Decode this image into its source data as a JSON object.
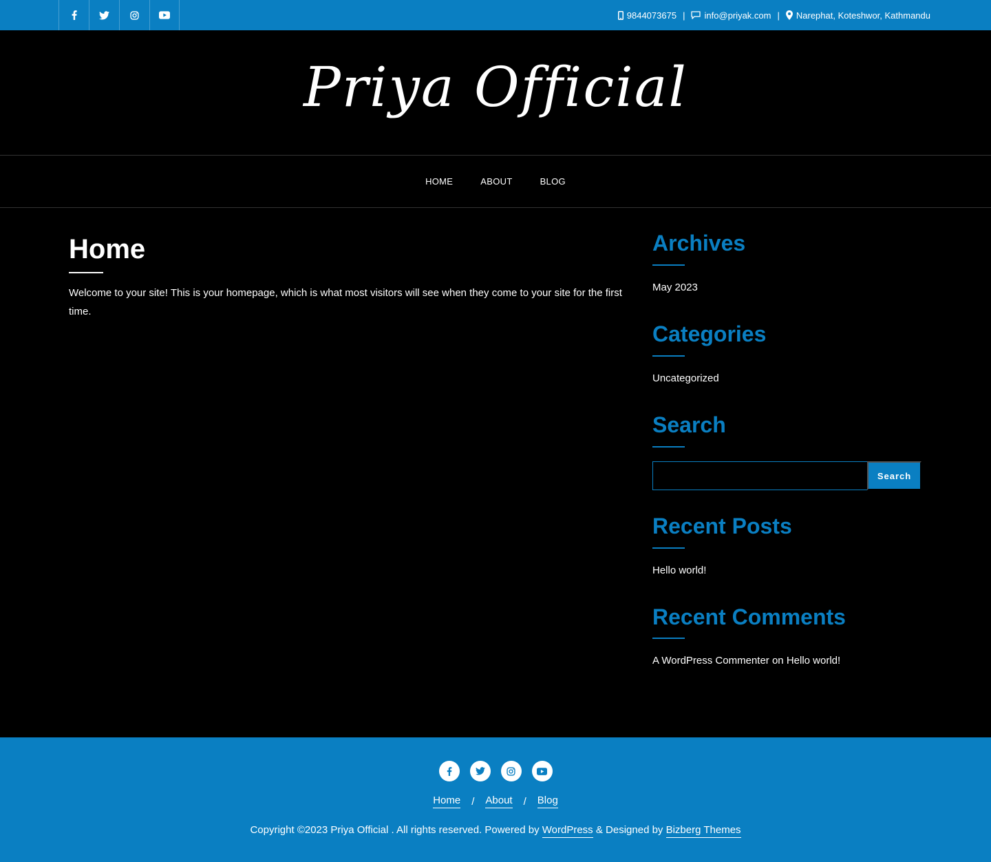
{
  "topbar": {
    "social": [
      "facebook-icon",
      "twitter-icon",
      "instagram-icon",
      "youtube-icon"
    ],
    "phone": "9844073675",
    "email": "info@priyak.com",
    "address": "Narephat, Koteshwor, Kathmandu",
    "separator": "|"
  },
  "site": {
    "title": "Priya Official"
  },
  "nav": {
    "items": [
      "HOME",
      "ABOUT",
      "BLOG"
    ]
  },
  "main": {
    "title": "Home",
    "text": "Welcome to your site! This is your homepage, which is what most visitors will see when they come to your site for the first time."
  },
  "sidebar": {
    "archives": {
      "title": "Archives",
      "items": [
        "May 2023"
      ]
    },
    "categories": {
      "title": "Categories",
      "items": [
        "Uncategorized"
      ]
    },
    "search": {
      "title": "Search",
      "placeholder": "",
      "button": "Search"
    },
    "recent_posts": {
      "title": "Recent Posts",
      "items": [
        "Hello world!"
      ]
    },
    "recent_comments": {
      "title": "Recent Comments",
      "author": "A WordPress Commenter",
      "on": "on",
      "post": "Hello world!"
    }
  },
  "footer": {
    "nav": [
      "Home",
      "About",
      "Blog"
    ],
    "nav_separator": "/",
    "copyright_prefix": "Copyright ©2023 Priya Official . All rights reserved. Powered by",
    "wordpress": "WordPress",
    "designed_by": "& Designed by",
    "theme_author": "Bizberg Themes"
  },
  "colors": {
    "accent": "#0a7fc2",
    "background": "#000000",
    "text": "#ffffff"
  }
}
